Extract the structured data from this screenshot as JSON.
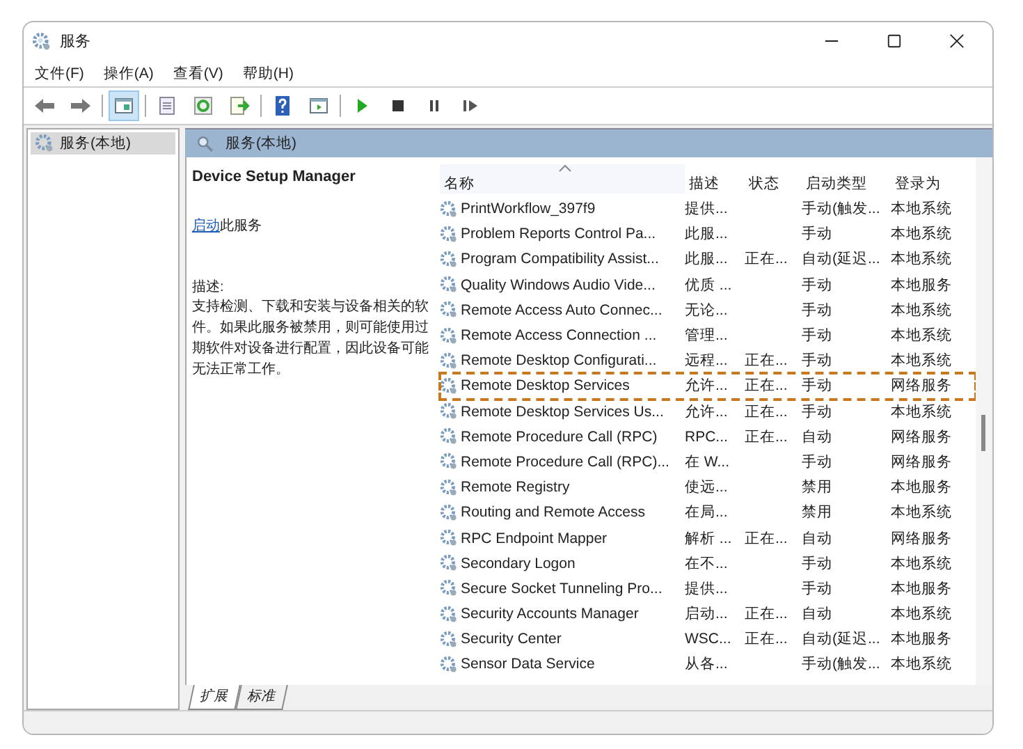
{
  "window": {
    "title": "服务"
  },
  "menu": [
    "文件(F)",
    "操作(A)",
    "查看(V)",
    "帮助(H)"
  ],
  "toolbar": [
    [
      {
        "kind": "back",
        "pressed": false
      },
      {
        "kind": "forward",
        "pressed": false
      }
    ],
    [
      {
        "kind": "tree",
        "pressed": true
      }
    ],
    [
      {
        "kind": "properties",
        "pressed": false
      },
      {
        "kind": "refresh",
        "pressed": false
      },
      {
        "kind": "export",
        "pressed": false
      }
    ],
    [
      {
        "kind": "help",
        "pressed": false
      },
      {
        "kind": "view",
        "pressed": false
      }
    ],
    [
      {
        "kind": "play",
        "pressed": false
      },
      {
        "kind": "stop",
        "pressed": false
      },
      {
        "kind": "pause",
        "pressed": false
      },
      {
        "kind": "resume",
        "pressed": false
      }
    ]
  ],
  "tree": {
    "items": [
      {
        "label": "服务(本地)",
        "selected": true
      }
    ]
  },
  "panel": {
    "title": "服务(本地)"
  },
  "details": {
    "service_name": "Device Setup Manager",
    "action_link": "启动",
    "action_text": "此服务",
    "description_label": "描述:",
    "description": "支持检测、下载和安装与设备相关的软件。如果此服务被禁用，则可能使用过期软件对设备进行配置，因此设备可能无法正常工作。"
  },
  "table": {
    "columns": [
      {
        "label": "名称",
        "sorted": true
      },
      {
        "label": "描述",
        "sorted": false
      },
      {
        "label": "状态",
        "sorted": false
      },
      {
        "label": "启动类型",
        "sorted": false
      },
      {
        "label": "登录为",
        "sorted": false
      }
    ],
    "rows": [
      {
        "name": "PrintWorkflow_397f9",
        "description": "提供...",
        "status": "",
        "startup_type": "手动(触发...",
        "log_on_as": "本地系统",
        "highlighted": false
      },
      {
        "name": "Problem Reports Control Pa...",
        "description": "此服...",
        "status": "",
        "startup_type": "手动",
        "log_on_as": "本地系统",
        "highlighted": false
      },
      {
        "name": "Program Compatibility Assist...",
        "description": "此服...",
        "status": "正在...",
        "startup_type": "自动(延迟...",
        "log_on_as": "本地系统",
        "highlighted": false
      },
      {
        "name": "Quality Windows Audio Vide...",
        "description": "优质 ...",
        "status": "",
        "startup_type": "手动",
        "log_on_as": "本地服务",
        "highlighted": false
      },
      {
        "name": "Remote Access Auto Connec...",
        "description": "无论...",
        "status": "",
        "startup_type": "手动",
        "log_on_as": "本地系统",
        "highlighted": false
      },
      {
        "name": "Remote Access Connection ...",
        "description": "管理...",
        "status": "",
        "startup_type": "手动",
        "log_on_as": "本地系统",
        "highlighted": false
      },
      {
        "name": "Remote Desktop Configurati...",
        "description": "远程...",
        "status": "正在...",
        "startup_type": "手动",
        "log_on_as": "本地系统",
        "highlighted": false
      },
      {
        "name": "Remote Desktop Services",
        "description": "允许...",
        "status": "正在...",
        "startup_type": "手动",
        "log_on_as": "网络服务",
        "highlighted": true
      },
      {
        "name": "Remote Desktop Services Us...",
        "description": "允许...",
        "status": "正在...",
        "startup_type": "手动",
        "log_on_as": "本地系统",
        "highlighted": false
      },
      {
        "name": "Remote Procedure Call (RPC)",
        "description": "RPC...",
        "status": "正在...",
        "startup_type": "自动",
        "log_on_as": "网络服务",
        "highlighted": false
      },
      {
        "name": "Remote Procedure Call (RPC)...",
        "description": "在 W...",
        "status": "",
        "startup_type": "手动",
        "log_on_as": "网络服务",
        "highlighted": false
      },
      {
        "name": "Remote Registry",
        "description": "使远...",
        "status": "",
        "startup_type": "禁用",
        "log_on_as": "本地服务",
        "highlighted": false
      },
      {
        "name": "Routing and Remote Access",
        "description": "在局...",
        "status": "",
        "startup_type": "禁用",
        "log_on_as": "本地系统",
        "highlighted": false
      },
      {
        "name": "RPC Endpoint Mapper",
        "description": "解析 ...",
        "status": "正在...",
        "startup_type": "自动",
        "log_on_as": "网络服务",
        "highlighted": false
      },
      {
        "name": "Secondary Logon",
        "description": "在不...",
        "status": "",
        "startup_type": "手动",
        "log_on_as": "本地系统",
        "highlighted": false
      },
      {
        "name": "Secure Socket Tunneling Pro...",
        "description": "提供...",
        "status": "",
        "startup_type": "手动",
        "log_on_as": "本地服务",
        "highlighted": false
      },
      {
        "name": "Security Accounts Manager",
        "description": "启动...",
        "status": "正在...",
        "startup_type": "自动",
        "log_on_as": "本地系统",
        "highlighted": false
      },
      {
        "name": "Security Center",
        "description": "WSC...",
        "status": "正在...",
        "startup_type": "自动(延迟...",
        "log_on_as": "本地服务",
        "highlighted": false
      },
      {
        "name": "Sensor Data Service",
        "description": "从各...",
        "status": "",
        "startup_type": "手动(触发...",
        "log_on_as": "本地系统",
        "highlighted": false
      }
    ]
  },
  "view_tabs": [
    {
      "label": "扩展",
      "selected": true
    },
    {
      "label": "标准",
      "selected": false
    }
  ]
}
